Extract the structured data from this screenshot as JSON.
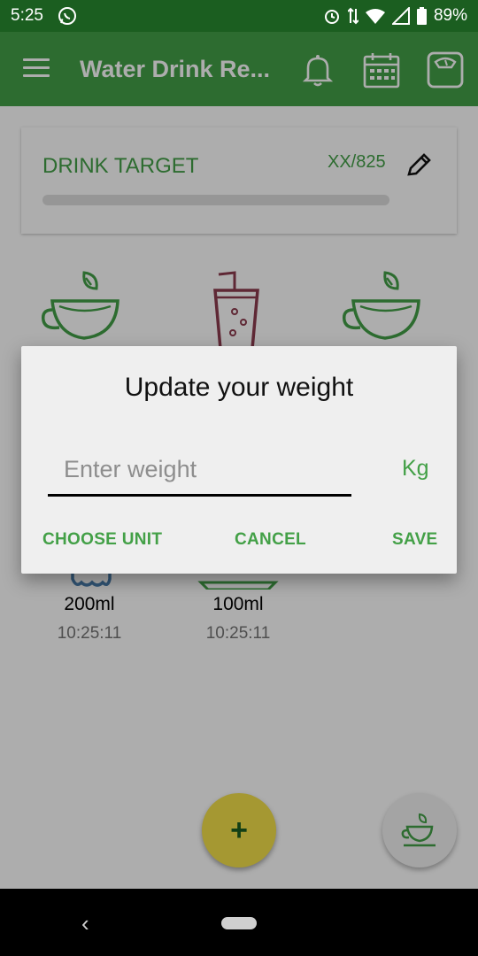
{
  "status_bar": {
    "time": "5:25",
    "battery_percent": "89%",
    "icons": [
      "whatsapp-icon",
      "alarm-icon",
      "data-arrows-icon",
      "wifi-icon",
      "signal-icon",
      "battery-icon"
    ]
  },
  "app_bar": {
    "title": "Water Drink Re...",
    "actions": [
      "bell-icon",
      "calendar-icon",
      "scale-icon"
    ],
    "color": "#43a047"
  },
  "drink_target": {
    "title": "DRINK TARGET",
    "count": "XX/825",
    "progress": 0
  },
  "drinks": [
    {
      "icon": "green-tea-cup-icon",
      "amount": "200ml",
      "time": "10:25:11"
    },
    {
      "icon": "soda-glass-icon",
      "amount": "100ml",
      "time": "10:25:11"
    },
    {
      "icon": "green-tea-cup-icon",
      "amount": "",
      "time": ""
    }
  ],
  "fab": {
    "label": "+",
    "color": "#f4e04a"
  },
  "dialog": {
    "title": "Update your weight",
    "input_placeholder": "Enter weight",
    "input_value": "",
    "unit": "Kg",
    "buttons": {
      "choose_unit": "CHOOSE UNIT",
      "cancel": "CANCEL",
      "save": "SAVE"
    }
  },
  "colors": {
    "accent": "#43a047",
    "status_bar": "#1b5e20"
  }
}
